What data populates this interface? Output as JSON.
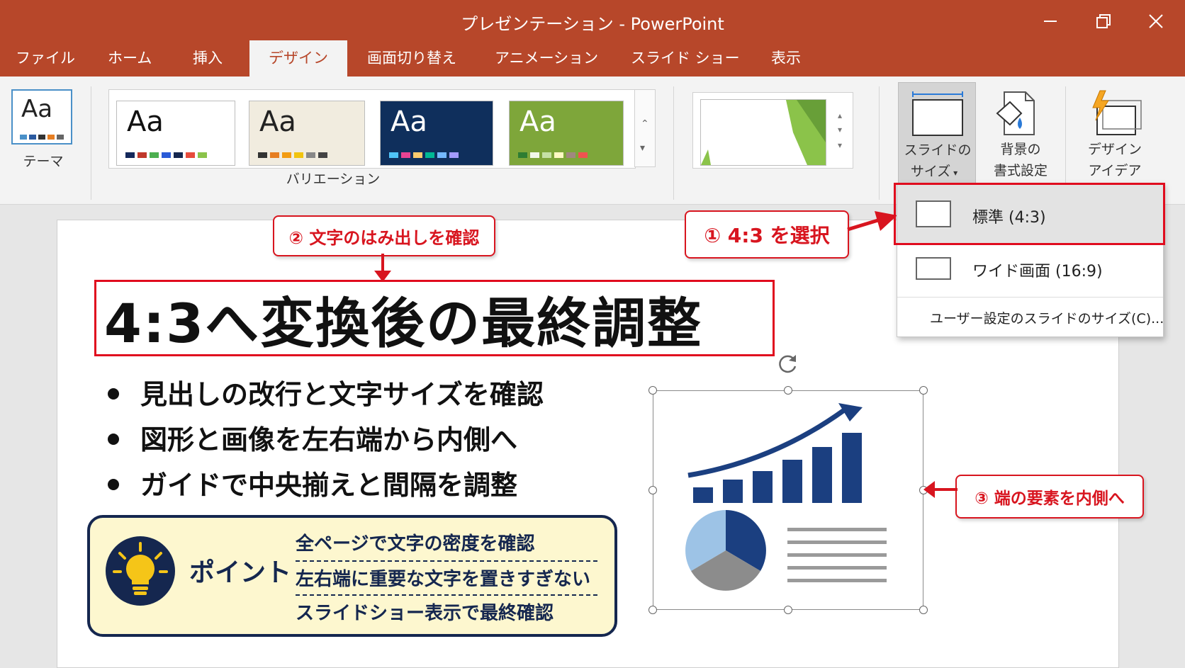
{
  "window": {
    "title": "プレゼンテーション - PowerPoint",
    "minimize_icon": "minimize-icon",
    "restore_icon": "restore-icon",
    "close_icon": "close-icon"
  },
  "tabs": [
    {
      "label": "ファイル"
    },
    {
      "label": "ホーム"
    },
    {
      "label": "挿入"
    },
    {
      "label": "デザイン",
      "active": true
    },
    {
      "label": "画面切り替え"
    },
    {
      "label": "アニメーション"
    },
    {
      "label": "スライド ショー"
    },
    {
      "label": "表示"
    }
  ],
  "ribbon": {
    "theme_label": "テーマ",
    "theme_thumb_text": "Aa",
    "variations_label": "バリエーション",
    "variations": [
      {
        "text": "Aa",
        "bg": "#ffffff",
        "fg": "#111111"
      },
      {
        "text": "Aa",
        "bg": "#f1ecdf",
        "fg": "#222222"
      },
      {
        "text": "Aa",
        "bg": "#0f2f5c",
        "fg": "#ffffff"
      },
      {
        "text": "Aa",
        "bg": "#7ea63a",
        "fg": "#ffffff"
      }
    ],
    "slide_size_label_1": "スライドの",
    "slide_size_label_2": "サイズ",
    "bg_format_label_1": "背景の",
    "bg_format_label_2": "書式設定",
    "design_ideas_label_1": "デザイン",
    "design_ideas_label_2": "アイデア"
  },
  "dropdown": {
    "items": [
      {
        "label": "標準 (4:3)",
        "selected": true
      },
      {
        "label": "ワイド画面 (16:9)",
        "selected": false
      }
    ],
    "custom_label": "ユーザー設定のスライドのサイズ(C)..."
  },
  "slide": {
    "title": "4:3へ変換後の最終調整",
    "bullets": [
      "見出しの改行と文字サイズを確認",
      "図形と画像を左右端から内側へ",
      "ガイドで中央揃えと間隔を調整"
    ],
    "point": {
      "label": "ポイント",
      "lines": [
        "全ページで文字の密度を確認",
        "左右端に重要な文字を置きすぎない",
        "スライドショー表示で最終確認"
      ]
    }
  },
  "callouts": {
    "step1": "① 4:3 を選択",
    "step2": "② 文字のはみ出しを確認",
    "step3": "③ 端の要素を内側へ"
  },
  "colors": {
    "accent": "#b7472a",
    "callout_red": "#d8151f",
    "navy": "#15274f",
    "chart_blue": "#1b3f80"
  }
}
